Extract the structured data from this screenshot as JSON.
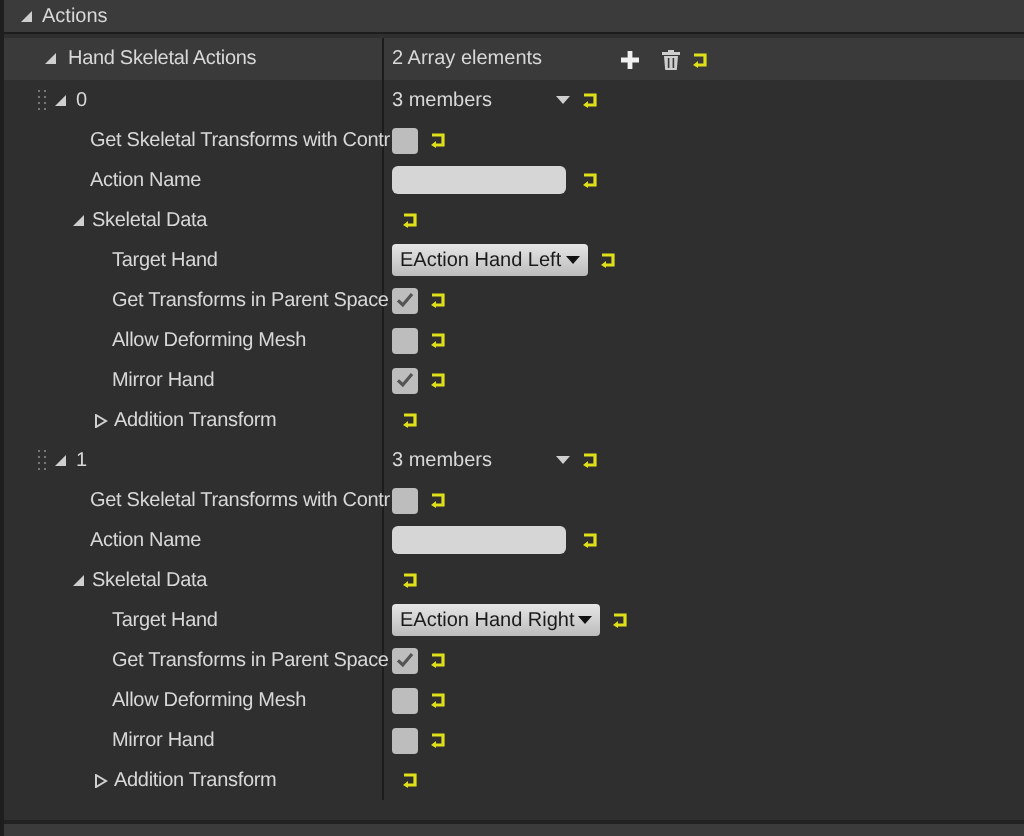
{
  "section": {
    "title": "Actions",
    "expanded": true
  },
  "array": {
    "label": "Hand Skeletal Actions",
    "expanded": true,
    "summary": "2 Array elements"
  },
  "elements": [
    {
      "index": "0",
      "expanded": true,
      "summary": "3 members",
      "properties": [
        {
          "kind": "checkbox",
          "label": "Get Skeletal Transforms with Contr",
          "checked": false
        },
        {
          "kind": "text",
          "label": "Action Name"
        },
        {
          "kind": "group",
          "label": "Skeletal Data",
          "expanded": true,
          "children": [
            {
              "kind": "dropdown",
              "label": "Target Hand",
              "value": "EAction Hand Left"
            },
            {
              "kind": "checkbox",
              "label": "Get Transforms in Parent Space",
              "checked": true
            },
            {
              "kind": "checkbox",
              "label": "Allow Deforming Mesh",
              "checked": false
            },
            {
              "kind": "checkbox",
              "label": "Mirror Hand",
              "checked": true
            },
            {
              "kind": "group",
              "label": "Addition Transform",
              "expanded": false
            }
          ]
        }
      ]
    },
    {
      "index": "1",
      "expanded": true,
      "summary": "3 members",
      "properties": [
        {
          "kind": "checkbox",
          "label": "Get Skeletal Transforms with Contr",
          "checked": false
        },
        {
          "kind": "text",
          "label": "Action Name"
        },
        {
          "kind": "group",
          "label": "Skeletal Data",
          "expanded": true,
          "children": [
            {
              "kind": "dropdown",
              "label": "Target Hand",
              "value": "EAction Hand Right"
            },
            {
              "kind": "checkbox",
              "label": "Get Transforms in Parent Space",
              "checked": true
            },
            {
              "kind": "checkbox",
              "label": "Allow Deforming Mesh",
              "checked": false
            },
            {
              "kind": "checkbox",
              "label": "Mirror Hand",
              "checked": false
            },
            {
              "kind": "group",
              "label": "Addition Transform",
              "expanded": false
            }
          ]
        }
      ]
    }
  ]
}
